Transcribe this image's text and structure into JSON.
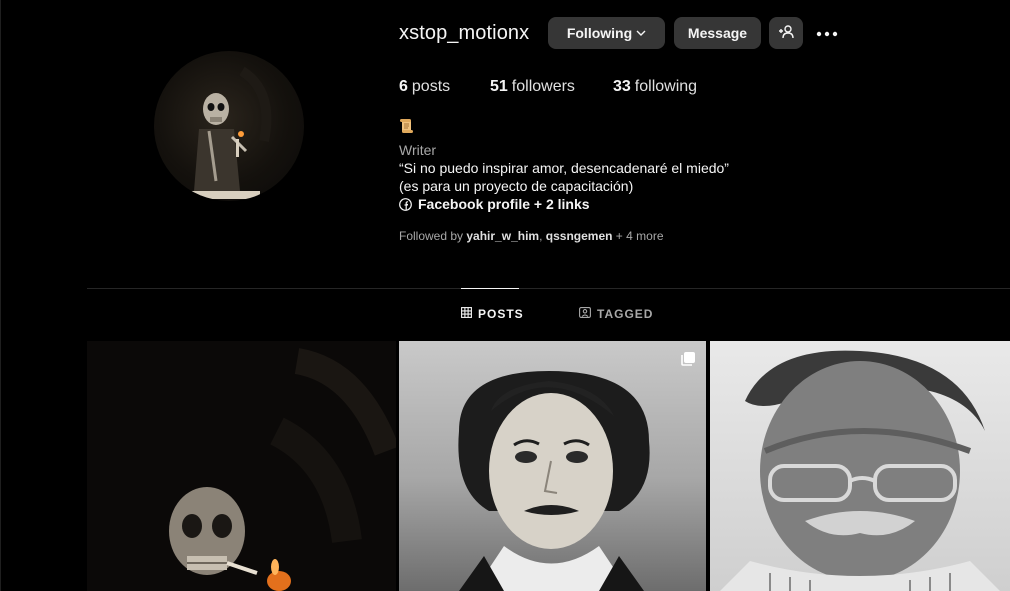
{
  "profile": {
    "username": "xstop_motionx",
    "buttons": {
      "following": "Following",
      "message": "Message"
    },
    "stats": {
      "posts_count": "6",
      "posts_label": "posts",
      "followers_count": "51",
      "followers_label": "followers",
      "following_count": "33",
      "following_label": "following"
    },
    "bio": {
      "category": "Writer",
      "line1": "“Si no puedo inspirar amor, desencadenaré el miedo”",
      "line2": "(es para un proyecto de capacitación)",
      "links": "Facebook profile + 2 links"
    },
    "followed_by": {
      "prefix": "Followed by",
      "user1": "yahir_w_him",
      "separator": ",",
      "user2": "qssngemen",
      "more": "+ 4 more"
    }
  },
  "tabs": {
    "posts": "POSTS",
    "tagged": "TAGGED"
  },
  "icons": {
    "following_chevron": "chevron-down-icon",
    "add_user": "add-user-icon",
    "more": "more-icon",
    "bio_emoji": "scroll-icon",
    "facebook": "facebook-icon",
    "posts_tab": "grid-icon",
    "tagged_tab": "tagged-icon",
    "carousel": "carousel-icon"
  },
  "colors": {
    "background": "#000000",
    "button": "#363636",
    "muted_text": "#a8a8a8"
  }
}
